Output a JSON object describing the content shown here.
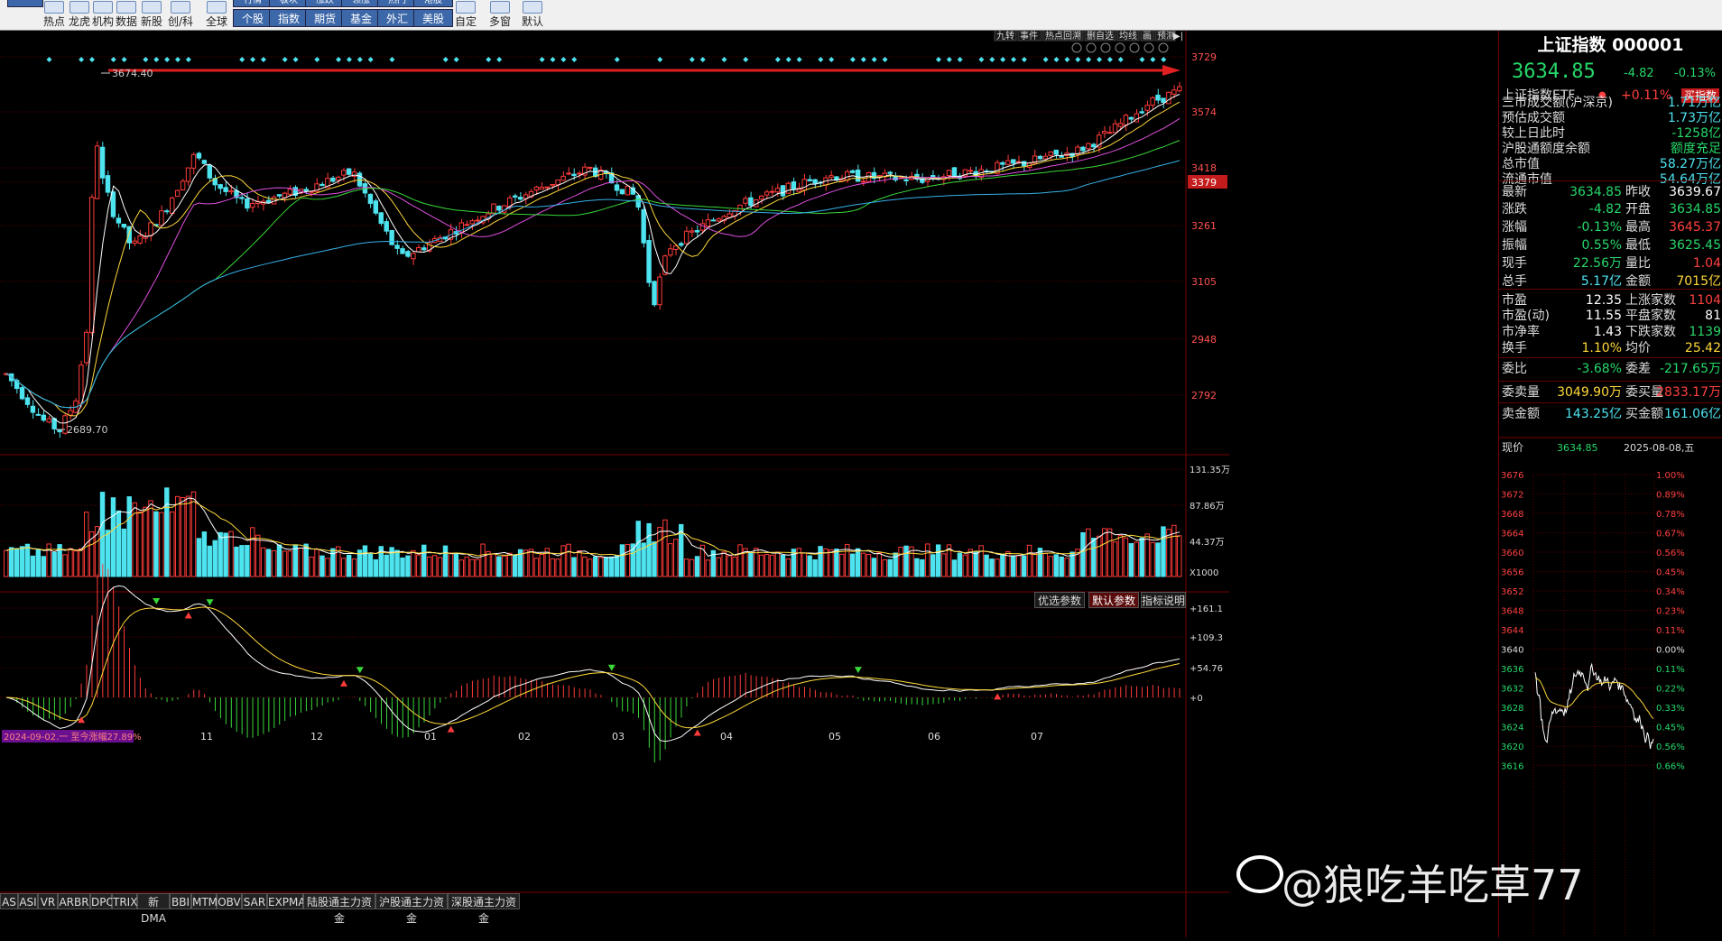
{
  "toolbar": {
    "buttons": [
      {
        "label": "热点",
        "icon": "hot-icon"
      },
      {
        "label": "龙虎",
        "icon": "dragon-tiger-icon"
      },
      {
        "label": "机构",
        "icon": "institution-icon"
      },
      {
        "label": "数据",
        "icon": "data-icon"
      },
      {
        "label": "新股",
        "icon": "new-stock-icon"
      },
      {
        "label": "创/科",
        "icon": "star-market-icon"
      },
      {
        "label": "全球",
        "icon": "globe-icon"
      },
      {
        "label": "自定",
        "icon": "custom-icon"
      },
      {
        "label": "多窗",
        "icon": "multi-window-icon"
      },
      {
        "label": "默认",
        "icon": "default-icon"
      }
    ],
    "tabs_top": [
      "行情",
      "板块",
      "涨跌",
      "领涨",
      "热门",
      "港股",
      "美股",
      "期货"
    ],
    "tabs": [
      "个股",
      "指数",
      "期货",
      "基金",
      "外汇",
      "美股"
    ]
  },
  "chart": {
    "tools": [
      "九转",
      "事件",
      "热点回溯",
      "删自选",
      "均线",
      "画",
      "预测"
    ],
    "price_axis": [
      "3729",
      "3574",
      "3418",
      "3379",
      "3261",
      "3105",
      "2948",
      "2792"
    ],
    "high_label": "3674.40",
    "low_label": "2689.70",
    "vol_axis": [
      "131.35万",
      "87.86万",
      "44.37万",
      "X1000"
    ],
    "macd_axis": [
      "+161.1",
      "+109.3",
      "+54.76",
      "+0"
    ],
    "param_buttons": [
      "优选参数",
      "默认参数",
      "指标说明"
    ],
    "months": [
      "11",
      "12",
      "01",
      "02",
      "03",
      "04",
      "05",
      "06",
      "07"
    ],
    "range_badge": "2024-09-02.一 至今涨幅27.89%"
  },
  "bottom_tabs": [
    "AS",
    "ASI",
    "VR",
    "ARBR",
    "DPO",
    "TRIX",
    "新DMA",
    "BBI",
    "MTM",
    "OBV",
    "SAR",
    "EXPMA",
    "陆股通主力资金",
    "沪股通主力资金",
    "深股通主力资金"
  ],
  "side": {
    "title": "上证指数 000001",
    "price": "3634.85",
    "change": "-4.82",
    "pct": "-0.13%",
    "etf": {
      "label": "上证指数ETF",
      "pct": "+0.11%",
      "btn": "买指数"
    },
    "info": [
      {
        "l": "三市成交额(沪深京)",
        "v": "1.71万亿"
      },
      {
        "l": "预估成交额",
        "v": "1.73万亿"
      },
      {
        "l": "较上日此时",
        "v": "-1258亿"
      },
      {
        "l": "沪股通额度余额",
        "v": "额度充足"
      },
      {
        "l": "总市值",
        "v": "58.27万亿"
      },
      {
        "l": "流通市值",
        "v": "54.64万亿"
      }
    ],
    "quote": [
      {
        "l1": "最新",
        "v1": "3634.85",
        "l2": "昨收",
        "v2": "3639.67"
      },
      {
        "l1": "涨跌",
        "v1": "-4.82",
        "l2": "开盘",
        "v2": "3634.85"
      },
      {
        "l1": "涨幅",
        "v1": "-0.13%",
        "l2": "最高",
        "v2": "3645.37"
      },
      {
        "l1": "振幅",
        "v1": "0.55%",
        "l2": "最低",
        "v2": "3625.45"
      },
      {
        "l1": "现手",
        "v1": "22.56万",
        "l2": "量比",
        "v2": "1.04"
      },
      {
        "l1": "总手",
        "v1": "5.17亿",
        "l2": "金额",
        "v2": "7015亿"
      },
      {
        "l1": "市盈",
        "v1": "12.35",
        "l2": "上涨家数",
        "v2": "1104"
      },
      {
        "l1": "市盈(动)",
        "v1": "11.55",
        "l2": "平盘家数",
        "v2": "81"
      },
      {
        "l1": "市净率",
        "v1": "1.43",
        "l2": "下跌家数",
        "v2": "1139"
      },
      {
        "l1": "换手",
        "v1": "1.10%",
        "l2": "均价",
        "v2": "25.42"
      },
      {
        "l1": "委比",
        "v1": "-3.68%",
        "l2": "委差",
        "v2": "-217.65万"
      },
      {
        "l1": "委卖量",
        "v1": "3049.90万",
        "l2": "委买量",
        "v2": "2833.17万"
      },
      {
        "l1": "卖金额",
        "v1": "143.25亿",
        "l2": "买金额",
        "v2": "161.06亿"
      }
    ],
    "mini": {
      "label": "现价",
      "price": "3634.85",
      "date": "2025-08-08,五",
      "left_axis": [
        "3676",
        "3672",
        "3668",
        "3664",
        "3660",
        "3656",
        "3652",
        "3648",
        "3644",
        "3640",
        "3636",
        "3632",
        "3628",
        "3624",
        "3620",
        "3616"
      ],
      "right_axis": [
        "1.00%",
        "0.89%",
        "0.78%",
        "0.67%",
        "0.56%",
        "0.45%",
        "0.34%",
        "0.23%",
        "0.11%",
        "0.00%",
        "0.11%",
        "0.22%",
        "0.33%",
        "0.45%",
        "0.56%",
        "0.66%"
      ]
    }
  },
  "watermark": "@狼吃羊吃草77"
}
